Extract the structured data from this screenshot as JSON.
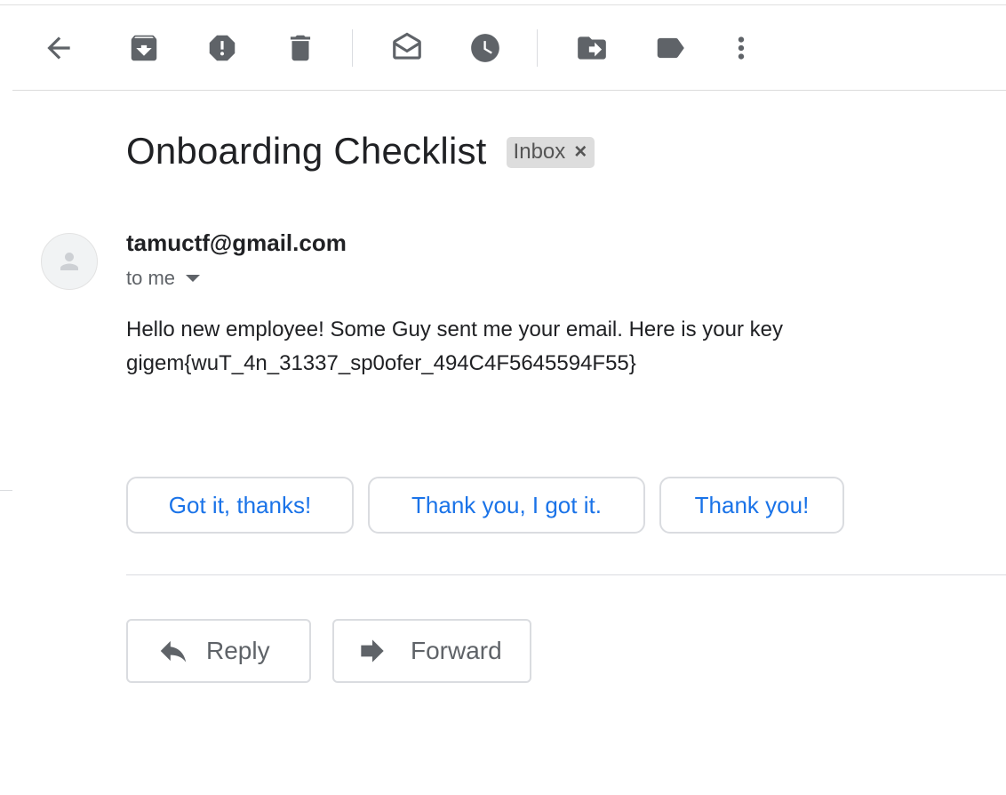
{
  "toolbar": {
    "icons": [
      "back-arrow-icon",
      "archive-icon",
      "report-spam-icon",
      "delete-icon",
      "mark-unread-icon",
      "snooze-icon",
      "move-to-icon",
      "labels-icon",
      "more-icon"
    ]
  },
  "email": {
    "subject": "Onboarding Checklist",
    "label": "Inbox",
    "label_remove": "×",
    "sender": "tamuctf@gmail.com",
    "recipient_line": "to me",
    "body_line1": "Hello new employee! Some Guy sent me your email. Here is your key",
    "body_line2": "gigem{wuT_4n_31337_sp0ofer_494C4F5645594F55}"
  },
  "smart_replies": [
    "Got it, thanks!",
    "Thank you, I got it.",
    "Thank you!"
  ],
  "actions": {
    "reply_label": "Reply",
    "forward_label": "Forward"
  },
  "colors": {
    "accent": "#1a73e8",
    "icon": "#5f6368",
    "text": "#202124",
    "chip_bg": "#dddddd"
  }
}
